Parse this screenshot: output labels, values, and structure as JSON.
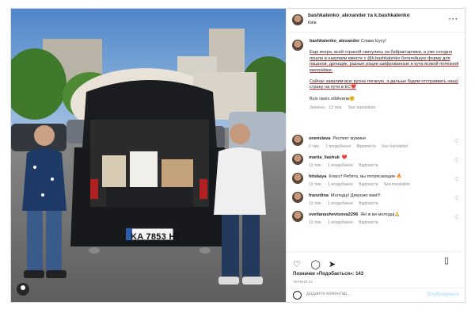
{
  "post": {
    "header": {
      "names": "bashkalenko_alexander та k.bashkalenko",
      "location": "Київ",
      "more_icon": "more-horizontal-icon"
    },
    "photo": {
      "plate": "KA 7853 HT"
    },
    "caption": {
      "username": "bashkalenko_alexander",
      "first_line": "Слава Ісусу!",
      "para1": "Еще вчера, всей страной скинулись на байрактарчики, а уже сегодня пошли и накупили вместе с @k.bashkalenko богатейшую форму для пацанов, дронщик, разные рации шифрованные и куча всякой полезной мелочёвки.",
      "para2": "Сейчас завалим всю русню поганую, а дальше будем отстраивать нашу страну на пути в ЕС❤️",
      "para3": "Всіх своїх обійняли🤗",
      "meta_edited": "Змінено · 13 тиж.",
      "meta_translation": "See translation"
    },
    "comments": [
      {
        "user": "onenslava",
        "text": "Респект мужики",
        "time": "6 тиж.",
        "likes": "1 вподобання",
        "reply": "Відповісти",
        "translation": "See translation"
      },
      {
        "user": "mariia_liashuk",
        "text": "❤️",
        "time": "13 тиж.",
        "likes": "1 вподобання",
        "reply": "Відповісти",
        "translation": ""
      },
      {
        "user": "hitskaya",
        "text": "Класс! Ребята, вы потрясающие 🔥",
        "time": "13 тиж.",
        "likes": "1 вподобання",
        "reply": "Відповісти",
        "translation": "See translation"
      },
      {
        "user": "franzdina",
        "text": "Молодці! Дякуємо вам!!!",
        "time": "13 тиж.",
        "likes": "1 вподобання",
        "reply": "Відповісти",
        "translation": ""
      },
      {
        "user": "svetlanashevtsova2296",
        "text": "Які ж ви молодці🙏",
        "time": "13 тиж.",
        "likes": "1 вподобання",
        "reply": "Відповісти",
        "translation": ""
      }
    ],
    "actions": {
      "like_icon": "heart-icon",
      "comment_icon": "comment-icon",
      "share_icon": "share-icon",
      "save_icon": "bookmark-icon"
    },
    "likes_text": "Позначки «Подобається»: 143",
    "date": "ЧЕРВНЯ 24",
    "add_comment": {
      "placeholder": "Додайте коментар…",
      "post_label": "Опублікувати"
    }
  },
  "colors": {
    "underline": "#d62828",
    "muted": "#8e8e8e",
    "post_button": "#b2dffc"
  }
}
